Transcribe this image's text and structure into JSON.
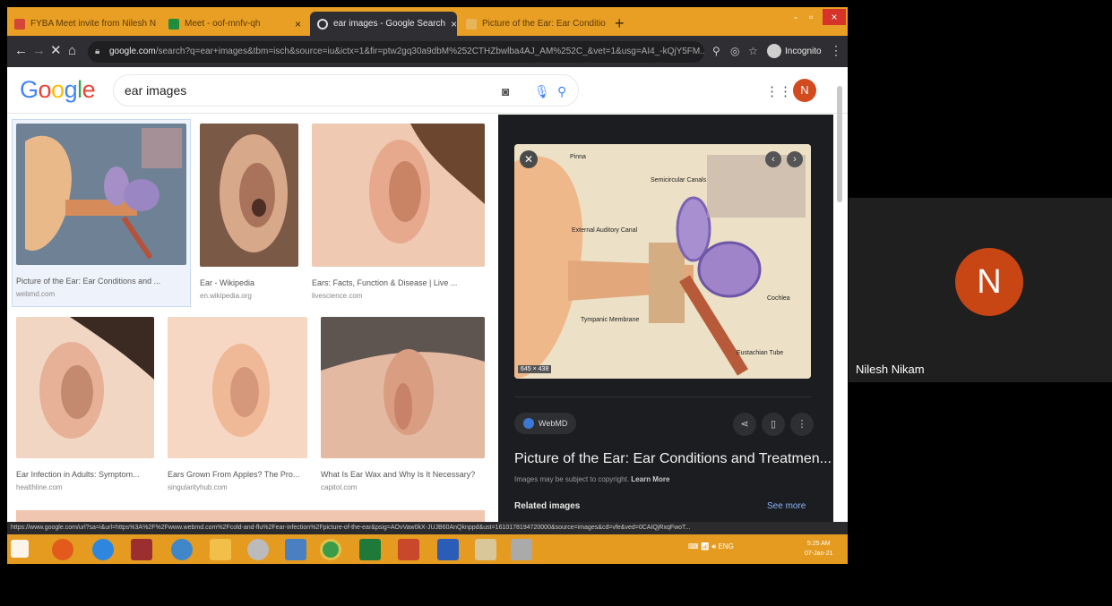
{
  "browser": {
    "tabs": [
      {
        "label": "FYBA Meet invite from Nilesh N",
        "close": "×",
        "favicon_color": "#d44638"
      },
      {
        "label": "Meet - oof-mnfv-qh",
        "close": "×",
        "favicon_color": "#1e8e3e"
      },
      {
        "label": "ear images - Google Search",
        "close": "×",
        "favicon_color": "#dddddd"
      },
      {
        "label": "Picture of the Ear: Ear Conditio",
        "close": "×",
        "favicon_color": "#e8b45a"
      }
    ],
    "new_tab": "+",
    "window_controls": {
      "minimize": "-",
      "maximize": "▫",
      "close": "×"
    },
    "url_host": "google.com",
    "url_path": "/search?q=ear+images&tbm=isch&source=iu&ictx=1&fir=ptw2gq30a9dbM%252CTHZbwlba4AJ_AM%252C_&vet=1&usg=AI4_-kQjY5FM...",
    "incognito_label": "Incognito"
  },
  "google": {
    "logo_letters": [
      {
        "ch": "G",
        "color": "#4285f4"
      },
      {
        "ch": "o",
        "color": "#ea4335"
      },
      {
        "ch": "o",
        "color": "#fbbc05"
      },
      {
        "ch": "g",
        "color": "#4285f4"
      },
      {
        "ch": "l",
        "color": "#34a853"
      },
      {
        "ch": "e",
        "color": "#ea4335"
      }
    ],
    "query": "ear images",
    "avatar_letter": "N"
  },
  "results": [
    {
      "caption": "Picture of the Ear: Ear Conditions and ...",
      "source": "webmd.com"
    },
    {
      "caption": "Ear - Wikipedia",
      "source": "en.wikipedia.org"
    },
    {
      "caption": "Ears: Facts, Function & Disease | Live ...",
      "source": "livescience.com"
    },
    {
      "caption": "Ear Infection in Adults: Symptom...",
      "source": "healthline.com"
    },
    {
      "caption": "Ears Grown From Apples? The Pro...",
      "source": "singularityhub.com"
    },
    {
      "caption": "What Is Ear Wax and Why Is It Necessary?",
      "source": "capitol.com"
    }
  ],
  "preview": {
    "dims": "645 × 438",
    "site": "WebMD",
    "title": "Picture of the Ear: Ear Conditions and Treatmen...",
    "copyright": "Images may be subject to copyright.",
    "learn_more": "Learn More",
    "related": "Related images",
    "see_more": "See more",
    "labels": {
      "pinna": "Pinna",
      "semicircular": "Semicircular Canals",
      "external": "External Auditory Canal",
      "cochlea": "Cochlea",
      "tympanic": "Tympanic Membrane",
      "eustachian": "Eustachian Tube"
    }
  },
  "status_url": "https://www.google.com/url?sa=i&url=https%3A%2F%2Fwww.webmd.com%2Fcold-and-flu%2Fear-infection%2Fpicture-of-the-ear&psig=AOvVaw0kX-JUJB60AnQknppd&ust=1610178194720000&source=images&cd=vfe&ved=0CAIQjRxqFwoT...",
  "taskbar": {
    "tray": "ENG",
    "time": "5:25 AM",
    "date": "07-Jan-21"
  },
  "meet": {
    "participant_name": "Nilesh Nikam",
    "participant_initial": "N"
  }
}
